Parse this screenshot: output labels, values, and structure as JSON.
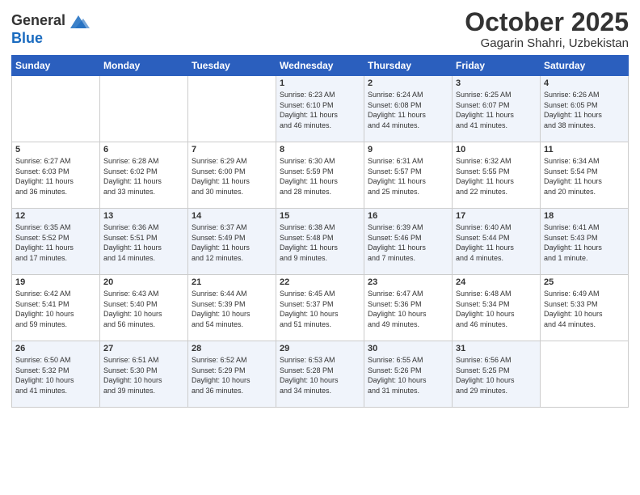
{
  "logo": {
    "line1": "General",
    "line2": "Blue"
  },
  "title": "October 2025",
  "subtitle": "Gagarin Shahri, Uzbekistan",
  "weekdays": [
    "Sunday",
    "Monday",
    "Tuesday",
    "Wednesday",
    "Thursday",
    "Friday",
    "Saturday"
  ],
  "weeks": [
    [
      {
        "day": "",
        "info": ""
      },
      {
        "day": "",
        "info": ""
      },
      {
        "day": "",
        "info": ""
      },
      {
        "day": "1",
        "info": "Sunrise: 6:23 AM\nSunset: 6:10 PM\nDaylight: 11 hours\nand 46 minutes."
      },
      {
        "day": "2",
        "info": "Sunrise: 6:24 AM\nSunset: 6:08 PM\nDaylight: 11 hours\nand 44 minutes."
      },
      {
        "day": "3",
        "info": "Sunrise: 6:25 AM\nSunset: 6:07 PM\nDaylight: 11 hours\nand 41 minutes."
      },
      {
        "day": "4",
        "info": "Sunrise: 6:26 AM\nSunset: 6:05 PM\nDaylight: 11 hours\nand 38 minutes."
      }
    ],
    [
      {
        "day": "5",
        "info": "Sunrise: 6:27 AM\nSunset: 6:03 PM\nDaylight: 11 hours\nand 36 minutes."
      },
      {
        "day": "6",
        "info": "Sunrise: 6:28 AM\nSunset: 6:02 PM\nDaylight: 11 hours\nand 33 minutes."
      },
      {
        "day": "7",
        "info": "Sunrise: 6:29 AM\nSunset: 6:00 PM\nDaylight: 11 hours\nand 30 minutes."
      },
      {
        "day": "8",
        "info": "Sunrise: 6:30 AM\nSunset: 5:59 PM\nDaylight: 11 hours\nand 28 minutes."
      },
      {
        "day": "9",
        "info": "Sunrise: 6:31 AM\nSunset: 5:57 PM\nDaylight: 11 hours\nand 25 minutes."
      },
      {
        "day": "10",
        "info": "Sunrise: 6:32 AM\nSunset: 5:55 PM\nDaylight: 11 hours\nand 22 minutes."
      },
      {
        "day": "11",
        "info": "Sunrise: 6:34 AM\nSunset: 5:54 PM\nDaylight: 11 hours\nand 20 minutes."
      }
    ],
    [
      {
        "day": "12",
        "info": "Sunrise: 6:35 AM\nSunset: 5:52 PM\nDaylight: 11 hours\nand 17 minutes."
      },
      {
        "day": "13",
        "info": "Sunrise: 6:36 AM\nSunset: 5:51 PM\nDaylight: 11 hours\nand 14 minutes."
      },
      {
        "day": "14",
        "info": "Sunrise: 6:37 AM\nSunset: 5:49 PM\nDaylight: 11 hours\nand 12 minutes."
      },
      {
        "day": "15",
        "info": "Sunrise: 6:38 AM\nSunset: 5:48 PM\nDaylight: 11 hours\nand 9 minutes."
      },
      {
        "day": "16",
        "info": "Sunrise: 6:39 AM\nSunset: 5:46 PM\nDaylight: 11 hours\nand 7 minutes."
      },
      {
        "day": "17",
        "info": "Sunrise: 6:40 AM\nSunset: 5:44 PM\nDaylight: 11 hours\nand 4 minutes."
      },
      {
        "day": "18",
        "info": "Sunrise: 6:41 AM\nSunset: 5:43 PM\nDaylight: 11 hours\nand 1 minute."
      }
    ],
    [
      {
        "day": "19",
        "info": "Sunrise: 6:42 AM\nSunset: 5:41 PM\nDaylight: 10 hours\nand 59 minutes."
      },
      {
        "day": "20",
        "info": "Sunrise: 6:43 AM\nSunset: 5:40 PM\nDaylight: 10 hours\nand 56 minutes."
      },
      {
        "day": "21",
        "info": "Sunrise: 6:44 AM\nSunset: 5:39 PM\nDaylight: 10 hours\nand 54 minutes."
      },
      {
        "day": "22",
        "info": "Sunrise: 6:45 AM\nSunset: 5:37 PM\nDaylight: 10 hours\nand 51 minutes."
      },
      {
        "day": "23",
        "info": "Sunrise: 6:47 AM\nSunset: 5:36 PM\nDaylight: 10 hours\nand 49 minutes."
      },
      {
        "day": "24",
        "info": "Sunrise: 6:48 AM\nSunset: 5:34 PM\nDaylight: 10 hours\nand 46 minutes."
      },
      {
        "day": "25",
        "info": "Sunrise: 6:49 AM\nSunset: 5:33 PM\nDaylight: 10 hours\nand 44 minutes."
      }
    ],
    [
      {
        "day": "26",
        "info": "Sunrise: 6:50 AM\nSunset: 5:32 PM\nDaylight: 10 hours\nand 41 minutes."
      },
      {
        "day": "27",
        "info": "Sunrise: 6:51 AM\nSunset: 5:30 PM\nDaylight: 10 hours\nand 39 minutes."
      },
      {
        "day": "28",
        "info": "Sunrise: 6:52 AM\nSunset: 5:29 PM\nDaylight: 10 hours\nand 36 minutes."
      },
      {
        "day": "29",
        "info": "Sunrise: 6:53 AM\nSunset: 5:28 PM\nDaylight: 10 hours\nand 34 minutes."
      },
      {
        "day": "30",
        "info": "Sunrise: 6:55 AM\nSunset: 5:26 PM\nDaylight: 10 hours\nand 31 minutes."
      },
      {
        "day": "31",
        "info": "Sunrise: 6:56 AM\nSunset: 5:25 PM\nDaylight: 10 hours\nand 29 minutes."
      },
      {
        "day": "",
        "info": ""
      }
    ]
  ]
}
